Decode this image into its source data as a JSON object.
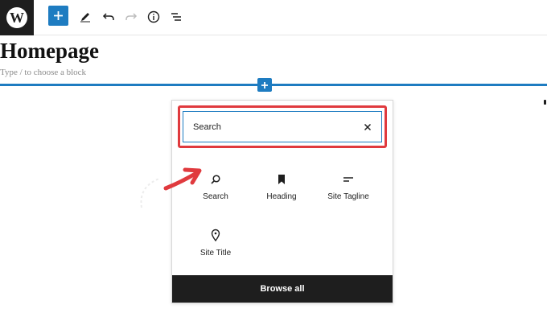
{
  "toolbar": {
    "logo": "W",
    "icons": [
      "wordpress-logo",
      "plus-icon",
      "pencil-icon",
      "undo-icon",
      "redo-icon",
      "info-icon",
      "list-view-icon"
    ]
  },
  "editor": {
    "title": "Homepage",
    "block_hint": "Type / to choose a block"
  },
  "inserter": {
    "search": {
      "value": "Search",
      "highlight_color": "#e03a3e"
    },
    "blocks": [
      {
        "label": "Search",
        "icon": "search-icon"
      },
      {
        "label": "Heading",
        "icon": "bookmark-icon"
      },
      {
        "label": "Site Tagline",
        "icon": "tagline-icon"
      },
      {
        "label": "Site Title",
        "icon": "map-marker-icon"
      }
    ],
    "browse_all_label": "Browse all"
  },
  "colors": {
    "accent": "#1e7cc1",
    "dark": "#1e1e1e",
    "annotation": "#e03a3e"
  }
}
